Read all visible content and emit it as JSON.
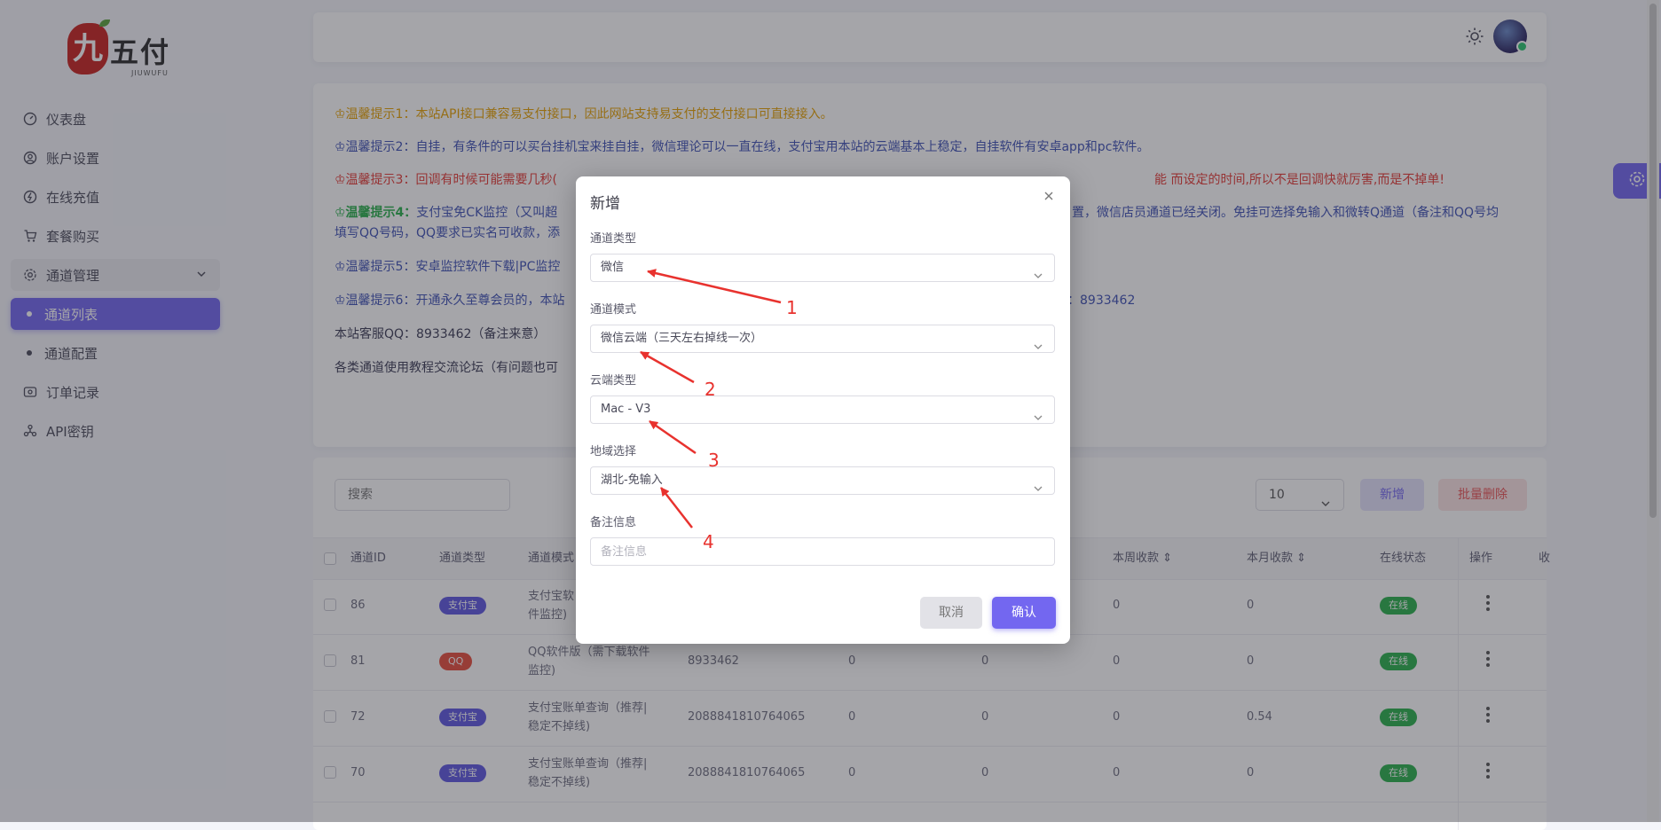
{
  "brand": {
    "logo_char": "九",
    "name": "五付",
    "sub": "JIUWUFU"
  },
  "sidebar": {
    "items": [
      {
        "label": "仪表盘",
        "icon": "dashboard-icon"
      },
      {
        "label": "账户设置",
        "icon": "user-settings-icon"
      },
      {
        "label": "在线充值",
        "icon": "recharge-icon"
      },
      {
        "label": "套餐购买",
        "icon": "cart-icon"
      },
      {
        "label": "通道管理",
        "icon": "settings-icon"
      },
      {
        "label": "通道列表"
      },
      {
        "label": "通道配置"
      },
      {
        "label": "订单记录",
        "icon": "order-icon"
      },
      {
        "label": "API密钥",
        "icon": "api-icon"
      }
    ]
  },
  "notices": {
    "tip1": "♔温馨提示1：本站API接口兼容易支付接口，因此网站支持易支付的支付接口可直接接入。",
    "tip2": "♔温馨提示2：自挂，有条件的可以买台挂机宝来挂自挂，微信理论可以一直在线，支付宝用本站的云端基本上稳定，自挂软件有安卓app和pc软件。",
    "tip3a": "♔温馨提示3：回调有时候可能需要几秒(",
    "tip3b": "能 而设定的时间,所以不是回调快就厉害,而是不掉单!",
    "tip4_head": "♔温馨提示4：",
    "tip4a": "支付宝免CK监控（又叫超",
    "tip4b": "置，微信店员通道已经关闭。免挂可选择免输入和微转Q通道（备注和QQ号均",
    "tip4c": "填写QQ号码，QQ要求已实名可收款，添",
    "tip5": "♔温馨提示5：安卓监控软件下载|PC监控",
    "tip6a": "♔温馨提示6：开通永久至尊会员的，本站",
    "tip6b": "：8933462",
    "service": "本站客服QQ：8933462（备注来意）",
    "forum": "各类通道使用教程交流论坛（有问题也可"
  },
  "toolbar": {
    "search_placeholder": "搜索",
    "page_size": "10",
    "add_label": "新增",
    "batch_delete_label": "批量删除"
  },
  "table": {
    "columns": [
      "通道ID",
      "通道类型",
      "通道模式",
      "本周收款",
      "本月收款",
      "在线状态",
      "操作",
      "收"
    ],
    "rows": [
      {
        "id": "86",
        "type": "支付宝",
        "mode1": "支付宝软",
        "mode2": "件监控)",
        "account": "",
        "c1": "",
        "c2": "",
        "week": "0",
        "month": "0",
        "status": "在线"
      },
      {
        "id": "81",
        "type": "QQ",
        "mode1": "QQ软件版（需下载软件",
        "mode2": "监控)",
        "account": "8933462",
        "c1": "0",
        "c2": "0",
        "week": "0",
        "month": "0",
        "status": "在线"
      },
      {
        "id": "72",
        "type": "支付宝",
        "mode1": "支付宝账单查询（推荐|",
        "mode2": "稳定不掉线)",
        "account": "2088841810764065",
        "c1": "0",
        "c2": "0",
        "week": "0",
        "month": "0.54",
        "status": "在线"
      },
      {
        "id": "70",
        "type": "支付宝",
        "mode1": "支付宝账单查询（推荐|",
        "mode2": "稳定不掉线)",
        "account": "2088841810764065",
        "c1": "0",
        "c2": "0",
        "week": "0",
        "month": "0",
        "status": "在线"
      }
    ]
  },
  "modal": {
    "title": "新增",
    "fields": {
      "channel_type": {
        "label": "通道类型",
        "value": "微信"
      },
      "channel_mode": {
        "label": "通道模式",
        "value": "微信云端（三天左右掉线一次）"
      },
      "cloud_type": {
        "label": "云端类型",
        "value": "Mac - V3"
      },
      "region": {
        "label": "地域选择",
        "value": "湖北-免输入"
      },
      "remark": {
        "label": "备注信息",
        "placeholder": "备注信息"
      }
    },
    "cancel_label": "取消",
    "confirm_label": "确认"
  },
  "annotations": [
    "1",
    "2",
    "3",
    "4"
  ],
  "colors": {
    "accent": "#7367f0",
    "alipay": "#5d56e0",
    "qq": "#e74c3c",
    "online": "#28b04b",
    "arrow": "#e8322e"
  }
}
